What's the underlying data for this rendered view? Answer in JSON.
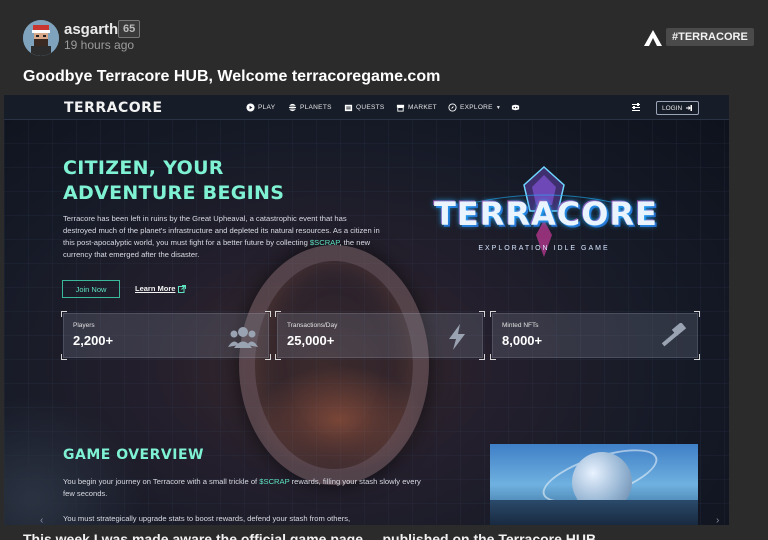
{
  "post": {
    "author": "asgarth",
    "reputation": "65",
    "time": "19 hours ago",
    "tag": "#TERRACORE",
    "title": "Goodbye Terracore HUB, Welcome terracoregame.com",
    "next_text_partial": "This week I was made aware the official game page ... published on the Terracore HUB"
  },
  "site": {
    "logo": "TERRACORE",
    "nav": {
      "play": "PLAY",
      "planets": "PLANETS",
      "quests": "QUESTS",
      "market": "MARKET",
      "explore": "EXPLORE",
      "login": "LOGIN"
    },
    "hero": {
      "title": "CITIZEN, YOUR ADVENTURE BEGINS",
      "desc_before": "Terracore has been left in ruins by the Great Upheaval, a catastrophic event that has destroyed much of the planet's infrastructure and depleted its natural resources. As a citizen in this post-apocalyptic world, you must fight for a better future by collecting ",
      "desc_highlight": "$SCRAP",
      "desc_after": ", the new currency that emerged after the disaster.",
      "join": "Join Now",
      "learn": "Learn More"
    },
    "stats": [
      {
        "label": "Players",
        "value": "2,200+",
        "icon": "users-icon"
      },
      {
        "label": "Transactions/Day",
        "value": "25,000+",
        "icon": "lightning-icon"
      },
      {
        "label": "Minted NFTs",
        "value": "8,000+",
        "icon": "hammer-icon"
      }
    ],
    "game_logo": {
      "word": "TERRACORE",
      "subtitle": "EXPLORATION IDLE GAME"
    },
    "overview": {
      "title": "GAME OVERVIEW",
      "p1_before": "You begin your journey on Terracore with a small trickle of ",
      "p1_highlight": "$SCRAP",
      "p1_after": " rewards, filling your stash slowly every few seconds.",
      "p2": "You must strategically upgrade stats to boost rewards, defend your stash from others,"
    }
  }
}
